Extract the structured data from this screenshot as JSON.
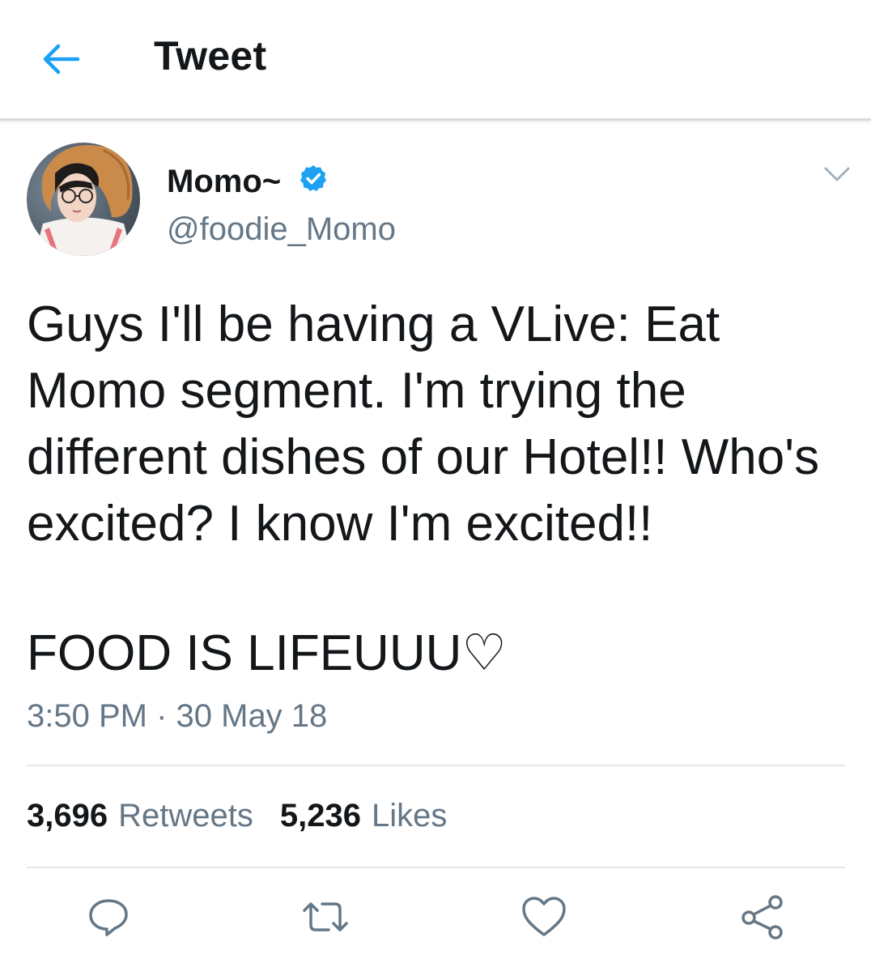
{
  "header": {
    "title": "Tweet",
    "back_icon": "arrow-left-icon"
  },
  "author": {
    "display_name": "Momo~",
    "handle": "@foodie_Momo",
    "verified": true
  },
  "tweet": {
    "paragraphs": [
      "Guys I'll be having a VLive: Eat Momo segment. I'm trying the different dishes of our Hotel!! Who's excited? I know I'm excited!!",
      "FOOD IS LIFEUUU♡"
    ],
    "timestamp": "3:50 PM · 30 May 18"
  },
  "stats": {
    "retweets_count": "3,696",
    "retweets_label": "Retweets",
    "likes_count": "5,236",
    "likes_label": "Likes"
  },
  "actions": [
    "reply-icon",
    "retweet-icon",
    "like-icon",
    "share-icon"
  ],
  "colors": {
    "accent": "#1da1f2",
    "text_primary": "#14171a",
    "text_secondary": "#657786",
    "divider": "#e1e8ed"
  }
}
